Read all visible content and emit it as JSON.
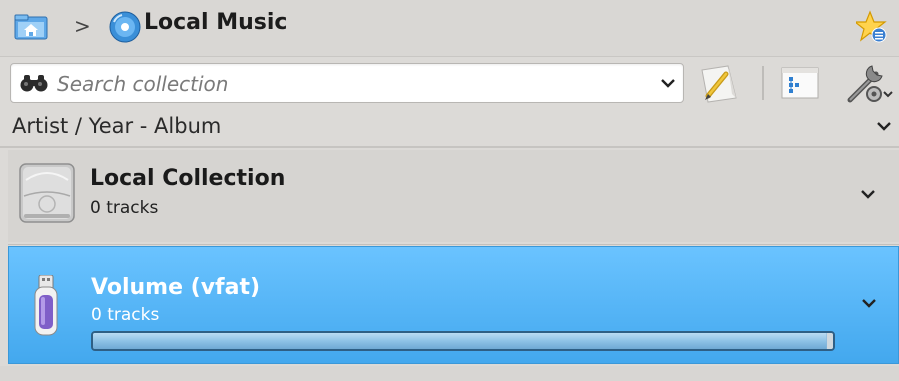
{
  "breadcrumb": {
    "separator": ">",
    "current": "Local Music"
  },
  "search": {
    "value": "",
    "placeholder": "Search collection"
  },
  "sort": {
    "label": "Artist / Year - Album"
  },
  "collections": [
    {
      "title": "Local Collection",
      "tracks": "0 tracks",
      "icon": "hard-drive-icon",
      "selected": false
    },
    {
      "title": "Volume (vfat)",
      "tracks": "0 tracks",
      "icon": "usb-drive-icon",
      "selected": true,
      "progress": 0.99
    }
  ],
  "colors": {
    "background": "#dcdad7",
    "selection": "#4cb0f2",
    "progress_border": "#2e5f85"
  }
}
